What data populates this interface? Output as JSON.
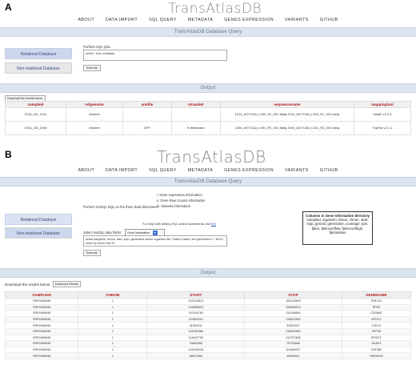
{
  "panel_a": {
    "letter": "A",
    "logo": "TransAtlasDB",
    "nav": [
      "ABOUT",
      "DATA IMPORT",
      "SQL QUERY",
      "METADATA",
      "GENES EXPRESSION",
      "VARIANTS",
      "GITHUB"
    ],
    "query_bar_title": "TransAtlasDB Database Query",
    "relational_label": "Relational Database",
    "nonrelational_label": "Non-relational Database",
    "prompt": "Perform SQL QGL",
    "query_text": "select * from metadata",
    "execute_label": "Execute",
    "output_title": "Output",
    "download_label": "Download the results below.",
    "table": {
      "headers": [
        "sampleid",
        "refgenome",
        "annfile",
        "stranded",
        "sequencename",
        "mappingtool"
      ],
      "rows": [
        [
          "GGA_UD_1014",
          "chicken",
          "",
          "",
          "1014_AGTCAA_L002_R1_001.fastq,1014_AGTCAA_L003_R1_001.fastq",
          "hisat2 v2.0.4"
        ],
        [
          "GGA_UD_1004",
          "chicken",
          "GFF",
          "fr-firststrand",
          "1004_AGTCAA_L001_R1_001.fastq,1004_AGTCAA_L001_R2_001.fastq",
          "TopHat v2.1.1"
        ]
      ]
    }
  },
  "panel_b": {
    "letter": "B",
    "logo": "TransAtlasDB",
    "nav": [
      "ABOUT",
      "DATA IMPORT",
      "SQL QUERY",
      "METADATA",
      "GENES EXPRESSION",
      "VARIANTS",
      "GITHUB"
    ],
    "query_bar_title": "TransAtlasDB Database Query",
    "relational_label": "Relational Database",
    "nonrelational_label": "Non-relational Database",
    "prompt": "Perform NoSQL DQL on the three data directories:",
    "directories": [
      "i.   Gene expression information",
      "ii.  Gene Raw Counts information",
      "iii. Variants information"
    ],
    "help_text": "For help with writing SQL select statements visit",
    "help_link": "W3",
    "select_label": "Select NoSQL data folder:",
    "select_value": "Gene Information",
    "query_text": "select sampleid, chrom, start, stop, genename where organism like \"Gallus Gallus\" and genename != \"NULL\" order by chrom limit 10",
    "execute_label": "Execute",
    "info_box": {
      "heading": "Columns in Gene Information directory",
      "body": "sampleid, organism, tissue, chrom, start, stop, geneid, genename, coverage, tpm, fpkm, fpkmconflow, fpkmconfhigh, fpkmstatus"
    },
    "output_title": "Output",
    "download_text": "Download the results below.",
    "download_label": "Download Results",
    "table": {
      "headers": [
        "SAMPLEID",
        "CHROM",
        "START",
        "STOP",
        "GENENAME"
      ],
      "rows": [
        [
          "SRR1606098",
          "1",
          "102133815",
          "102133609",
          "ZNF124"
        ],
        [
          "SRR1606098",
          "1",
          "102869629",
          "102869675",
          "RPS6"
        ],
        [
          "SRR1606098",
          "1",
          "110146784",
          "110146846",
          "CD36AP"
        ],
        [
          "SRR1606098",
          "1",
          "110820114",
          "110820363",
          "APOC1"
        ],
        [
          "SRR1606098",
          "1",
          "31502911",
          "31502937",
          "C7EC2"
        ],
        [
          "SRR1606098",
          "1",
          "115784386",
          "115803959",
          "ZFP36"
        ],
        [
          "SRR1606098",
          "1",
          "114697790",
          "114727458",
          "SPINT2"
        ],
        [
          "SRR1606098",
          "1",
          "75663369",
          "75733588",
          "GKAP1"
        ],
        [
          "SRR1606098",
          "1",
          "101549228",
          "101566207",
          "ZNF382"
        ],
        [
          "SRR1606098",
          "1",
          "46872065",
          "46605911",
          "TMEM242"
        ]
      ]
    }
  }
}
